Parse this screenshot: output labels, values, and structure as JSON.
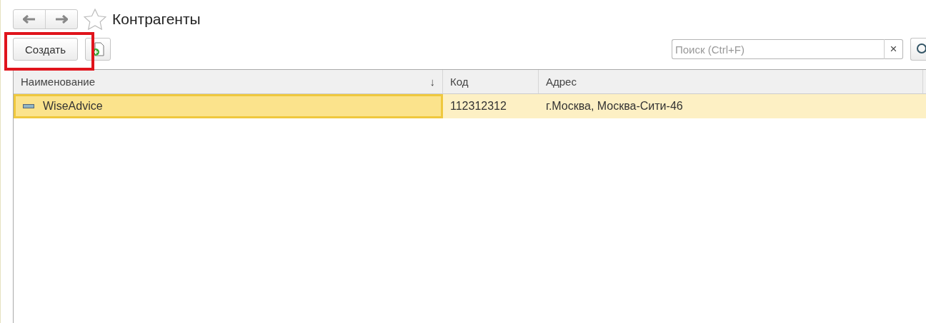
{
  "title": "Контрагенты",
  "toolbar": {
    "create_button": {
      "label": "Создать",
      "highlighted": true
    },
    "search": {
      "placeholder": "Поиск (Ctrl+F)",
      "clear": "×"
    }
  },
  "table": {
    "columns": [
      {
        "label": "Наименование",
        "sorted": true
      },
      {
        "label": "Код",
        "sorted": false
      },
      {
        "label": "Адрес",
        "sorted": false
      }
    ],
    "sort_mark": "↓",
    "rows": [
      {
        "cells": [
          "WiseAdvice",
          "112312312",
          "г.Москва, Москва-Сити-46"
        ],
        "selected": true
      }
    ]
  }
}
